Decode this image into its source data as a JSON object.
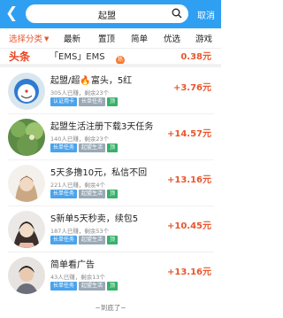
{
  "topbar": {
    "back_icon": "chevron-left-icon",
    "search_value": "起盟",
    "cancel_label": "取消"
  },
  "tabs": [
    {
      "label": "选择分类",
      "selected": true
    },
    {
      "label": "最新"
    },
    {
      "label": "置顶",
      "badge": "热"
    },
    {
      "label": "简单"
    },
    {
      "label": "优选"
    },
    {
      "label": "游戏"
    }
  ],
  "headline": {
    "label": "头条",
    "text": "「EMS」EMS",
    "price": "0.38元"
  },
  "tasks": [
    {
      "title": "起盟/超🔥富头，5红",
      "meta": "305人已赚，剩余23个",
      "tags": [
        "认证用卡",
        "长单任务",
        "顶"
      ],
      "price": "+3.76元"
    },
    {
      "title": "起盟生活注册下载3天任务",
      "meta": "140人已赚，剩余23个",
      "tags": [
        "长单任务",
        "起盟生活",
        "顶"
      ],
      "price": "+14.57元"
    },
    {
      "title": "5天多撸10元，私信不回",
      "meta": "221人已赚，剩余4个",
      "tags": [
        "长单任务",
        "起盟生活",
        "顶"
      ],
      "price": "+13.16元"
    },
    {
      "title": "S新单5天秒卖，续包5",
      "meta": "187人已赚，剩余53个",
      "tags": [
        "长单任务",
        "起盟生活",
        "顶"
      ],
      "price": "+10.45元"
    },
    {
      "title": "简单看广告",
      "meta": "43人已赚，剩余13个",
      "tags": [
        "长单任务",
        "起盟生活",
        "顶"
      ],
      "price": "+13.16元"
    }
  ],
  "footer": "~到底了~"
}
